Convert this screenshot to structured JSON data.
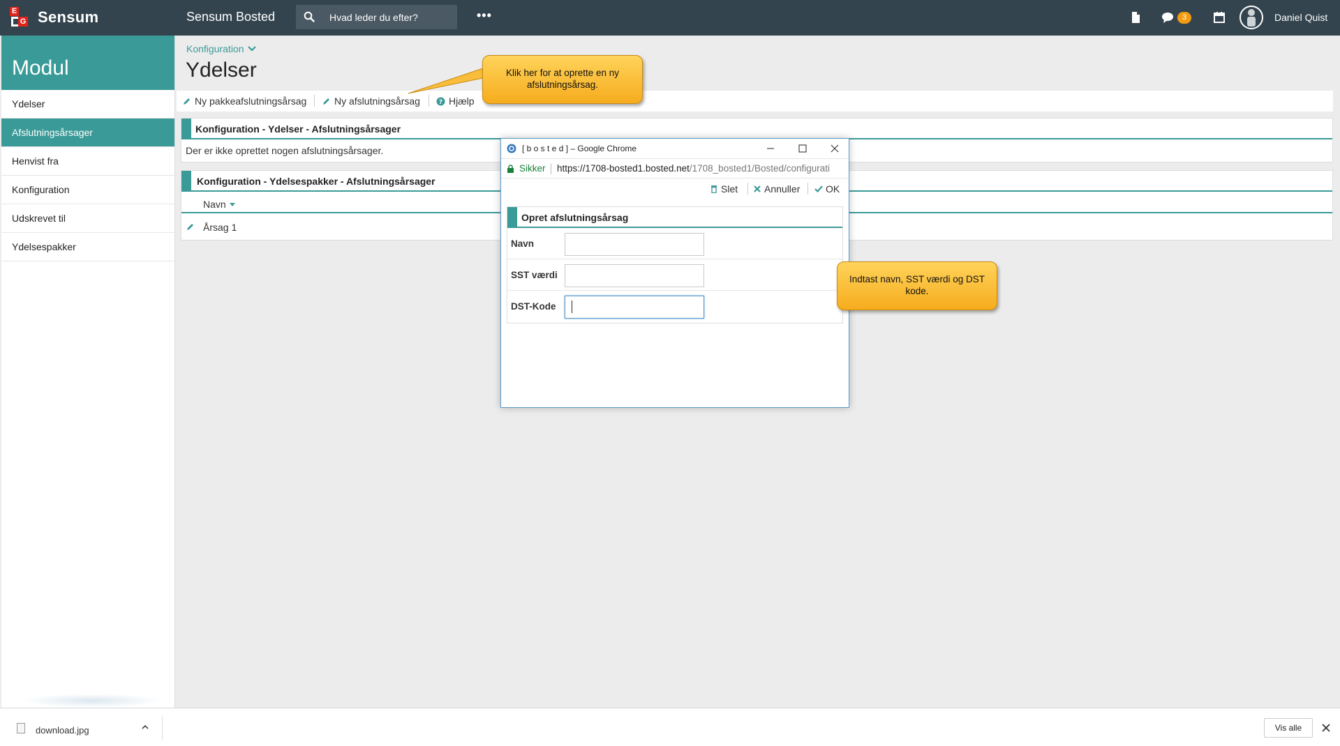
{
  "topbar": {
    "logo_text": "Sensum",
    "logo_e": "E",
    "logo_g": "G",
    "app_title": "Sensum Bosted",
    "search_placeholder": "Hvad leder du efter?",
    "more": "•••",
    "badge_count": "3",
    "username": "Daniel Quist"
  },
  "sidebar": {
    "title": "Modul",
    "items": [
      {
        "label": "Ydelser"
      },
      {
        "label": "Afslutningsårsager"
      },
      {
        "label": "Henvist fra"
      },
      {
        "label": "Konfiguration"
      },
      {
        "label": "Udskrevet til"
      },
      {
        "label": "Ydelsespakker"
      }
    ],
    "active_index": 1
  },
  "main": {
    "breadcrumb": "Konfiguration",
    "title": "Ydelser",
    "toolbar": {
      "new_package_reason": "Ny pakkeafslutningsårsag",
      "new_reason": "Ny afslutningsårsag",
      "help": "Hjælp"
    },
    "panel1": {
      "title": "Konfiguration - Ydelser - Afslutningsårsager",
      "empty_text": "Der er ikke oprettet nogen afslutningsårsager."
    },
    "panel2": {
      "title": "Konfiguration - Ydelsespakker - Afslutningsårsager",
      "column": "Navn",
      "rows": [
        {
          "name": "Årsag 1"
        }
      ]
    }
  },
  "callouts": {
    "create": "Klik her for at oprette en ny afslutningsårsag.",
    "enter": "Indtast navn, SST værdi og DST kode."
  },
  "popup": {
    "window_title": "[ b o s t e d ] – Google Chrome",
    "secure_label": "Sikker",
    "url_host": "https://1708-bosted1.bosted.net",
    "url_path": "/1708_bosted1/Bosted/configurati",
    "tools": {
      "delete": "Slet",
      "cancel": "Annuller",
      "ok": "OK"
    },
    "form": {
      "title": "Opret afslutningsårsag",
      "fields": [
        {
          "label": "Navn",
          "value": ""
        },
        {
          "label": "SST værdi",
          "value": ""
        },
        {
          "label": "DST-Kode",
          "value": ""
        }
      ]
    }
  },
  "downloads": {
    "file_name": "download.jpg",
    "show_all": "Vis alle"
  },
  "colors": {
    "topbar": "#34444e",
    "accent": "#3a9a97",
    "badge": "#f39c12",
    "callout": "#f6ac1e"
  }
}
